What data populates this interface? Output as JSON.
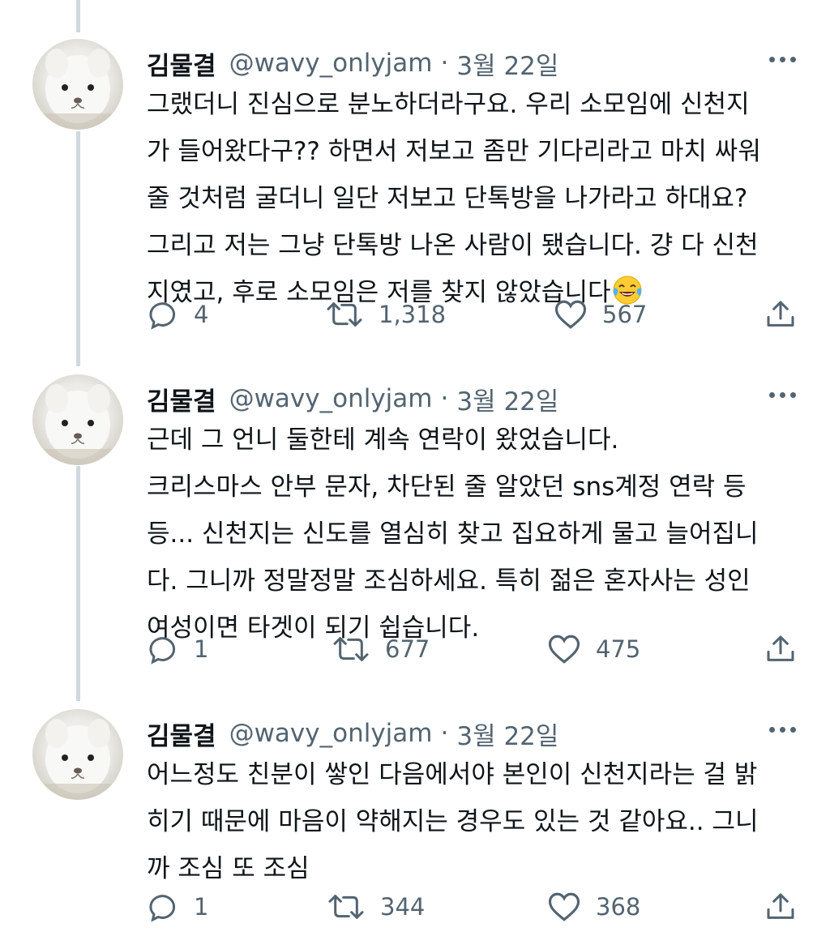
{
  "tweets": [
    {
      "author": {
        "name": "김물결",
        "handle": "@wavy_onlyjam",
        "separator": "·",
        "date": "3월 22일"
      },
      "lines": [
        "그랬더니 진심으로 분노하더라구요. 우리 소모임에 신천지",
        "가 들어왔다구?? 하면서 저보고 좀만 기다리라고 마치 싸워",
        "줄 것처럼 굴더니 일단 저보고 단톡방을 나가라고 하대요?",
        "그리고 저는 그냥 단톡방 나온 사람이 됐습니다. 걍 다 신천",
        "지였고, 후로 소모임은 저를 찾지 않았습니다"
      ],
      "trailing_emoji": "face-with-tears-of-joy",
      "stats": {
        "replies": "4",
        "retweets": "1,318",
        "likes": "567"
      }
    },
    {
      "author": {
        "name": "김물결",
        "handle": "@wavy_onlyjam",
        "separator": "·",
        "date": "3월 22일"
      },
      "lines": [
        "근데 그 언니 둘한테 계속 연락이 왔었습니다.",
        "크리스마스 안부 문자, 차단된 줄 알았던 sns계정 연락 등",
        "등... 신천지는 신도를 열심히 찾고 집요하게 물고 늘어집니",
        "다. 그니까 정말정말 조심하세요. 특히 젊은 혼자사는 성인",
        "여성이면 타겟이 되기 쉽습니다."
      ],
      "stats": {
        "replies": "1",
        "retweets": "677",
        "likes": "475"
      }
    },
    {
      "author": {
        "name": "김물결",
        "handle": "@wavy_onlyjam",
        "separator": "·",
        "date": "3월 22일"
      },
      "lines": [
        "어느정도 친분이 쌓인 다음에서야 본인이 신천지라는 걸 밝",
        "히기 때문에 마음이 약해지는 경우도 있는 것 같아요.. 그니",
        "까 조심 또 조심"
      ],
      "stats": {
        "replies": "1",
        "retweets": "344",
        "likes": "368"
      }
    }
  ],
  "icons": {
    "reply": "speech-bubble-icon",
    "retweet": "retweet-arrows-icon",
    "like": "heart-icon",
    "share": "share-upload-icon",
    "more": "more-dots-icon"
  },
  "colors": {
    "text": "#0f1419",
    "secondary": "#536471",
    "thread_line": "#cfd9de"
  }
}
